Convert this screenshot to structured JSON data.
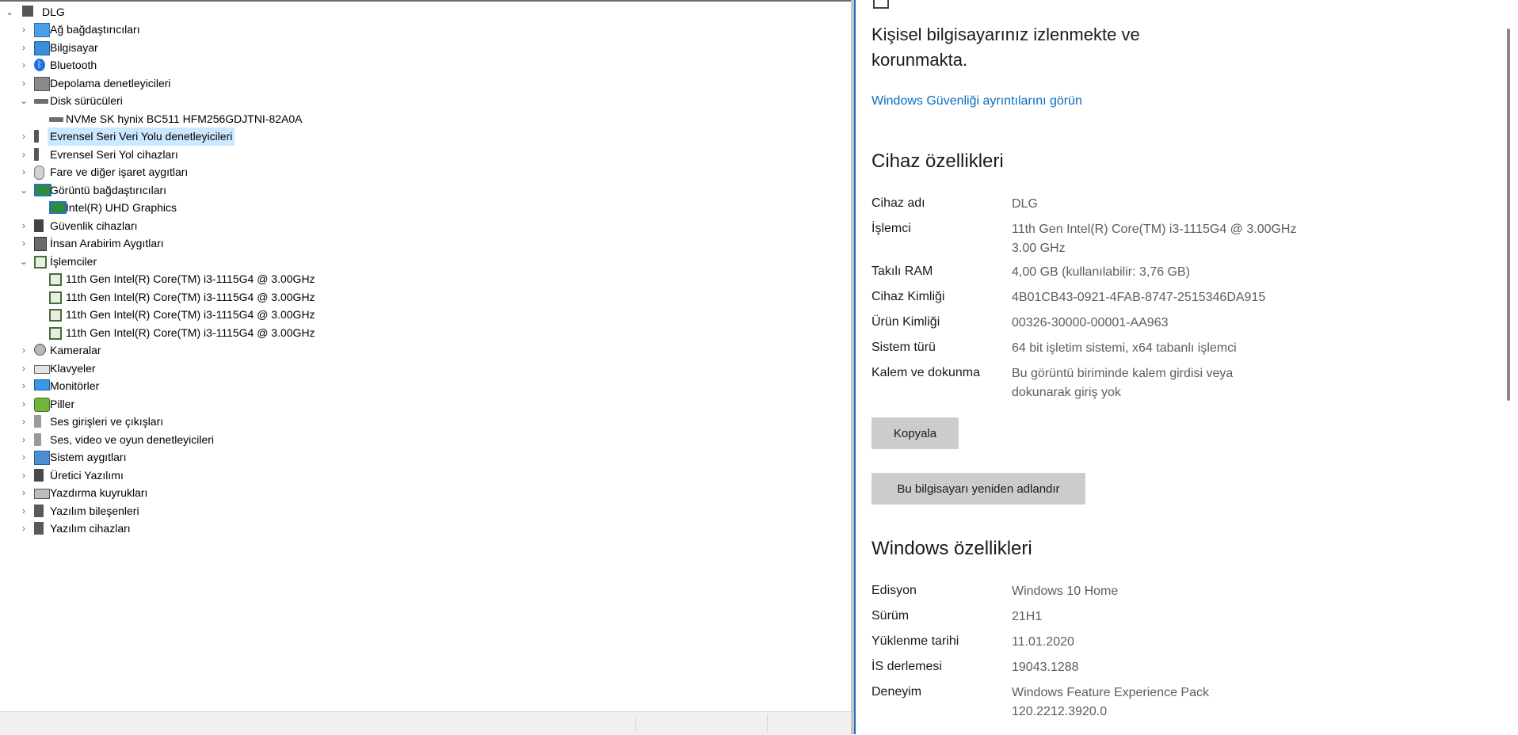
{
  "device_manager": {
    "root": "DLG",
    "items": [
      {
        "label": "Ağ bağdaştırıcıları",
        "icon": "network-adapter-icon",
        "expanded": false
      },
      {
        "label": "Bilgisayar",
        "icon": "computer-icon",
        "expanded": false
      },
      {
        "label": "Bluetooth",
        "icon": "bluetooth-icon",
        "expanded": false
      },
      {
        "label": "Depolama denetleyicileri",
        "icon": "storage-controller-icon",
        "expanded": false
      },
      {
        "label": "Disk sürücüleri",
        "icon": "disk-drive-icon",
        "expanded": true,
        "children": [
          {
            "label": "NVMe SK hynix BC511 HFM256GDJTNI-82A0A",
            "icon": "disk-drive-icon"
          }
        ]
      },
      {
        "label": "Evrensel Seri Veri Yolu denetleyicileri",
        "icon": "usb-icon",
        "expanded": false,
        "selected": true
      },
      {
        "label": "Evrensel Seri Yol cihazları",
        "icon": "usb-icon",
        "expanded": false
      },
      {
        "label": "Fare ve diğer işaret aygıtları",
        "icon": "mouse-icon",
        "expanded": false
      },
      {
        "label": "Görüntü bağdaştırıcıları",
        "icon": "display-adapter-icon",
        "expanded": true,
        "children": [
          {
            "label": "Intel(R) UHD Graphics",
            "icon": "display-adapter-icon"
          }
        ]
      },
      {
        "label": "Güvenlik cihazları",
        "icon": "security-device-icon",
        "expanded": false
      },
      {
        "label": "İnsan Arabirim Aygıtları",
        "icon": "hid-icon",
        "expanded": false
      },
      {
        "label": "İşlemciler",
        "icon": "processor-icon",
        "expanded": true,
        "children": [
          {
            "label": "11th Gen Intel(R) Core(TM) i3-1115G4 @ 3.00GHz",
            "icon": "processor-icon"
          },
          {
            "label": "11th Gen Intel(R) Core(TM) i3-1115G4 @ 3.00GHz",
            "icon": "processor-icon"
          },
          {
            "label": "11th Gen Intel(R) Core(TM) i3-1115G4 @ 3.00GHz",
            "icon": "processor-icon"
          },
          {
            "label": "11th Gen Intel(R) Core(TM) i3-1115G4 @ 3.00GHz",
            "icon": "processor-icon"
          }
        ]
      },
      {
        "label": "Kameralar",
        "icon": "camera-icon",
        "expanded": false
      },
      {
        "label": "Klavyeler",
        "icon": "keyboard-icon",
        "expanded": false
      },
      {
        "label": "Monitörler",
        "icon": "monitor-icon",
        "expanded": false
      },
      {
        "label": "Piller",
        "icon": "battery-icon",
        "expanded": false
      },
      {
        "label": "Ses girişleri ve çıkışları",
        "icon": "audio-io-icon",
        "expanded": false
      },
      {
        "label": "Ses, video ve oyun denetleyicileri",
        "icon": "sound-controller-icon",
        "expanded": false
      },
      {
        "label": "Sistem aygıtları",
        "icon": "system-device-icon",
        "expanded": false
      },
      {
        "label": "Üretici Yazılımı",
        "icon": "firmware-icon",
        "expanded": false
      },
      {
        "label": "Yazdırma kuyrukları",
        "icon": "printer-icon",
        "expanded": false
      },
      {
        "label": "Yazılım bileşenleri",
        "icon": "software-component-icon",
        "expanded": false
      },
      {
        "label": "Yazılım cihazları",
        "icon": "software-device-icon",
        "expanded": false
      }
    ]
  },
  "about": {
    "protection_text": "Kişisel bilgisayarınız izlenmekte ve korunmakta.",
    "security_link": "Windows Güvenliği ayrıntılarını görün",
    "device_specs_title": "Cihaz özellikleri",
    "device_specs": [
      {
        "label": "Cihaz adı",
        "value": "DLG"
      },
      {
        "label": "İşlemci",
        "value": "11th Gen Intel(R) Core(TM) i3-1115G4 @ 3.00GHz",
        "value2": "3.00 GHz"
      },
      {
        "label": "Takılı RAM",
        "value": "4,00 GB (kullanılabilir: 3,76 GB)"
      },
      {
        "label": "Cihaz Kimliği",
        "value": "4B01CB43-0921-4FAB-8747-2515346DA915"
      },
      {
        "label": "Ürün Kimliği",
        "value": "00326-30000-00001-AA963"
      },
      {
        "label": "Sistem türü",
        "value": "64 bit işletim sistemi, x64 tabanlı işlemci"
      },
      {
        "label": "Kalem ve dokunma",
        "value": "Bu görüntü biriminde kalem girdisi veya",
        "value2": "dokunarak giriş yok"
      }
    ],
    "copy_button": "Kopyala",
    "rename_button": "Bu bilgisayarı yeniden adlandır",
    "windows_specs_title": "Windows özellikleri",
    "windows_specs": [
      {
        "label": "Edisyon",
        "value": "Windows 10 Home"
      },
      {
        "label": "Sürüm",
        "value": "21H1"
      },
      {
        "label": "Yüklenme tarihi",
        "value": "11.01.2020"
      },
      {
        "label": "İS derlemesi",
        "value": "19043.1288"
      },
      {
        "label": "Deneyim",
        "value": "Windows Feature Experience Pack",
        "value2": "120.2212.3920.0"
      }
    ]
  },
  "colors": {
    "link": "#0b6cbd",
    "selection": "#cce8ff",
    "button": "#cccccc"
  }
}
